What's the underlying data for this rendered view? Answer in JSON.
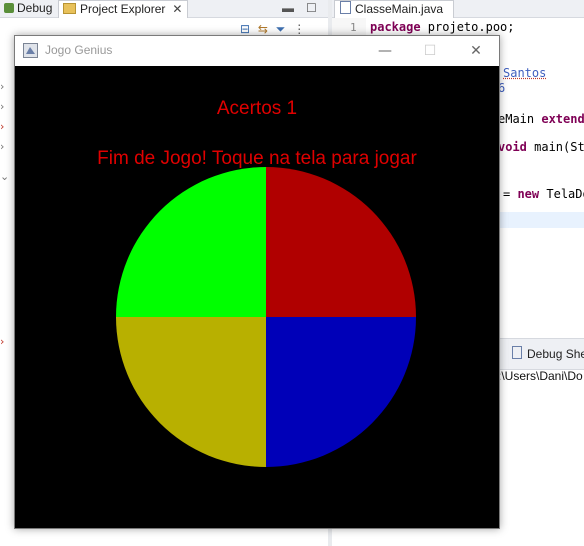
{
  "ide": {
    "tabs_left": [
      {
        "label": "Debug"
      },
      {
        "label": "Project Explorer"
      }
    ],
    "tab_right": {
      "label": "ClasseMain.java"
    },
    "code": {
      "line1_num": "1",
      "line1_kw": "package",
      "line1_rest": " projeto.poo;",
      "frag_santos": "Santos",
      "frag_6": "6",
      "frag_main_pre": "eMain ",
      "frag_extends": "extends",
      "frag_void": "void",
      "frag_main_call": " main(Str",
      "frag_eq": "= ",
      "frag_new": "new",
      "frag_teladc": " TelaDo"
    },
    "debug_shell_label": "Debug She",
    "path_text": ":\\Users\\Dani\\Do"
  },
  "window": {
    "title": "Jogo Genius",
    "min": "—",
    "max": "☐",
    "close": "✕"
  },
  "game": {
    "score_text": "Acertos 1",
    "status_text": "Fim de Jogo! Toque na tela para jogar",
    "text_color": "#e00000",
    "colors": {
      "green": "#00ff00",
      "red": "#b00000",
      "yellow": "#b8b000",
      "blue": "#0000b8"
    }
  }
}
